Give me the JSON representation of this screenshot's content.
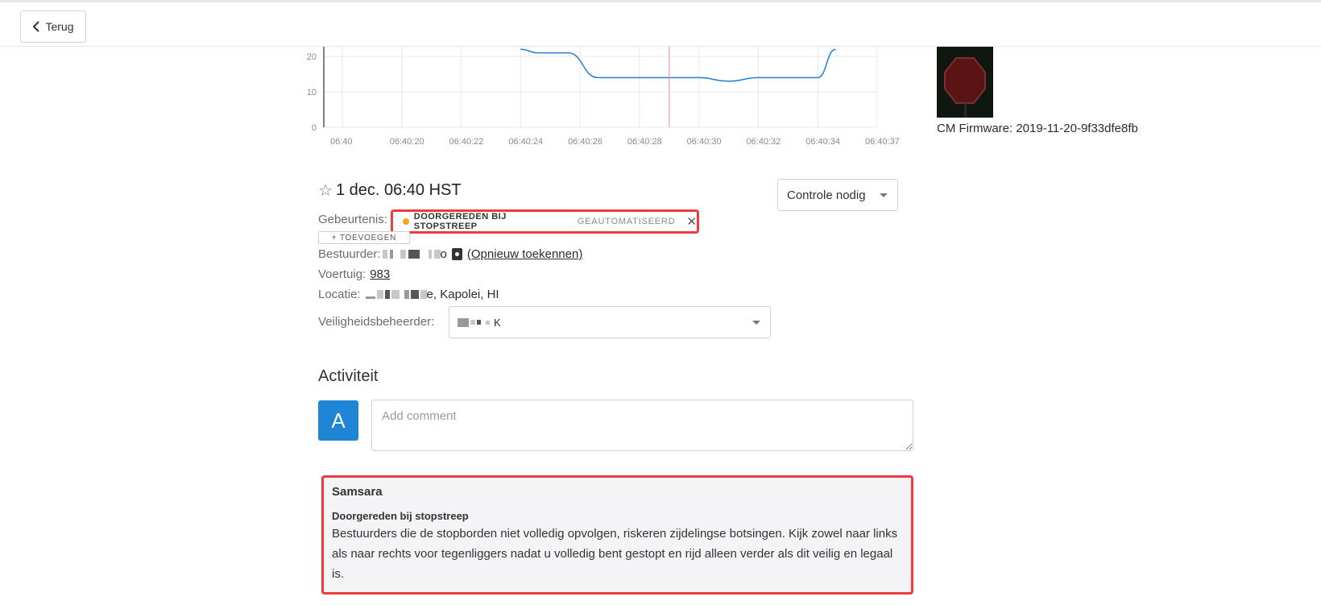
{
  "nav": {
    "back_label": "Terug"
  },
  "chart_data": {
    "type": "line",
    "x_ticks": [
      "06:40",
      "06:40:20",
      "06:40:22",
      "06:40:24",
      "06:40:26",
      "06:40:28",
      "06:40:30",
      "06:40:32",
      "06:40:34",
      "06:40:37"
    ],
    "y_ticks": [
      "0",
      "10",
      "20"
    ],
    "series": [
      {
        "points": [
          [
            3.0,
            22
          ],
          [
            3.3,
            21
          ],
          [
            3.8,
            21
          ],
          [
            4.3,
            14
          ],
          [
            5.2,
            14
          ],
          [
            6.0,
            14
          ],
          [
            6.5,
            13
          ],
          [
            7.0,
            14
          ],
          [
            7.5,
            14
          ],
          [
            8.0,
            14
          ],
          [
            8.3,
            22
          ]
        ]
      }
    ],
    "marker_x": 5.5,
    "colors": {
      "line": "#1f7fd6",
      "marker": "#f08a8a"
    }
  },
  "device": {
    "firmware": "CM Firmware: 2019-11-20-9f33dfe8fb"
  },
  "event": {
    "title": "1 dec. 06:40 HST",
    "status": "Controle nodig",
    "labels": {
      "event": "Gebeurtenis:",
      "driver": "Bestuurder:",
      "vehicle": "Voertuig:",
      "location": "Locatie:",
      "safety_manager": "Veiligheidsbeheerder:"
    },
    "tag": {
      "label": "DOORGEREDEN BIJ STOPSTREEP",
      "auto": "GEAUTOMATISEERD",
      "dot_color": "#f4a61c"
    },
    "add_label": "+ TOEVOEGEN",
    "driver_partial": "o",
    "reassign": "(Opnieuw toekennen)",
    "vehicle": "983",
    "location_partial": "e, Kapolei, HI",
    "manager_partial": "K"
  },
  "activity": {
    "title": "Activiteit",
    "avatar_letter": "A",
    "comment_placeholder": "Add comment",
    "coaching": {
      "author": "Samsara",
      "type": "Doorgereden bij stopstreep",
      "text": "Bestuurders die de stopborden niet volledig opvolgen, riskeren zijdelingse botsingen. Kijk zowel naar links als naar rechts voor tegenliggers nadat u volledig bent gestopt en rijd alleen verder als dit veilig en legaal is."
    }
  }
}
